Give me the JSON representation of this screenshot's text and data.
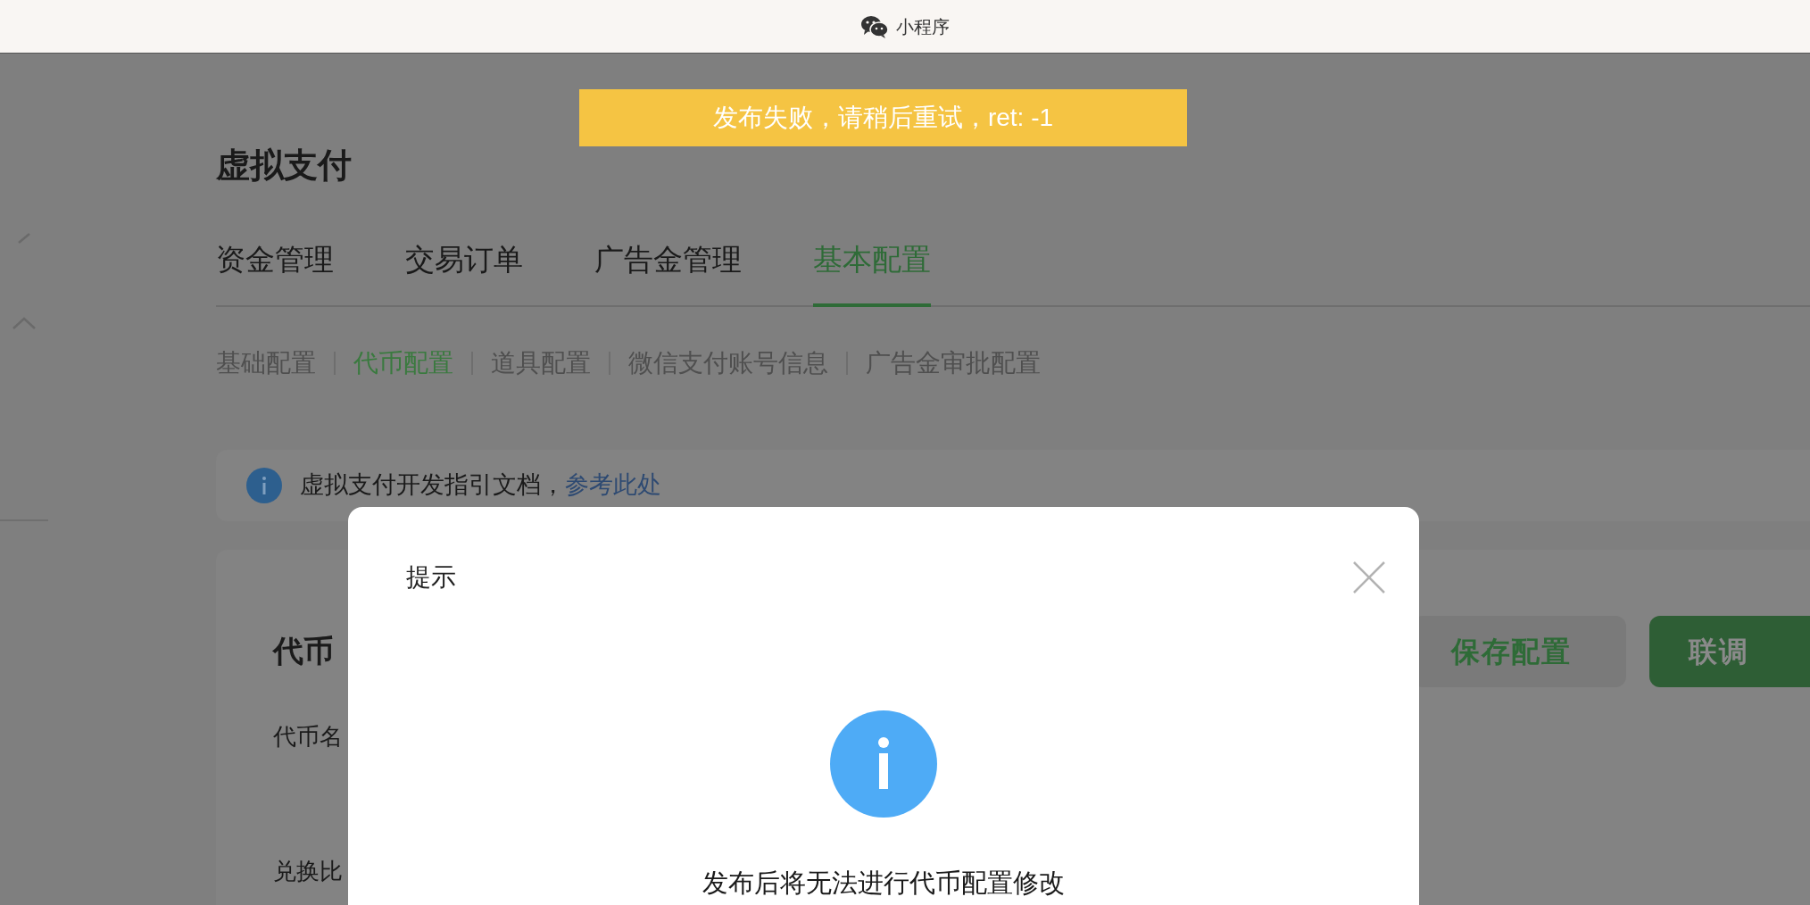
{
  "window": {
    "title": "小程序"
  },
  "toast": {
    "text": "发布失败，请稍后重试，ret: -1"
  },
  "page_title": "虚拟支付",
  "tabs": [
    {
      "label": "资金管理",
      "selected": false
    },
    {
      "label": "交易订单",
      "selected": false
    },
    {
      "label": "广告金管理",
      "selected": false
    },
    {
      "label": "基本配置",
      "selected": true
    }
  ],
  "sub_tabs": [
    {
      "label": "基础配置",
      "selected": false
    },
    {
      "label": "代币配置",
      "selected": true
    },
    {
      "label": "道具配置",
      "selected": false
    },
    {
      "label": "微信支付账号信息",
      "selected": false
    },
    {
      "label": "广告金审批配置",
      "selected": false
    }
  ],
  "notice": {
    "text": "虚拟支付开发指引文档，",
    "link": "参考此处"
  },
  "card": {
    "title": "代币",
    "fields": [
      "代币名",
      "兑换比"
    ],
    "buttons": [
      {
        "label": "保存配置",
        "kind": "secondary"
      },
      {
        "label": "联调",
        "kind": "primary"
      }
    ]
  },
  "dialog": {
    "title": "提示",
    "message": "发布后将无法进行代币配置修改"
  }
}
